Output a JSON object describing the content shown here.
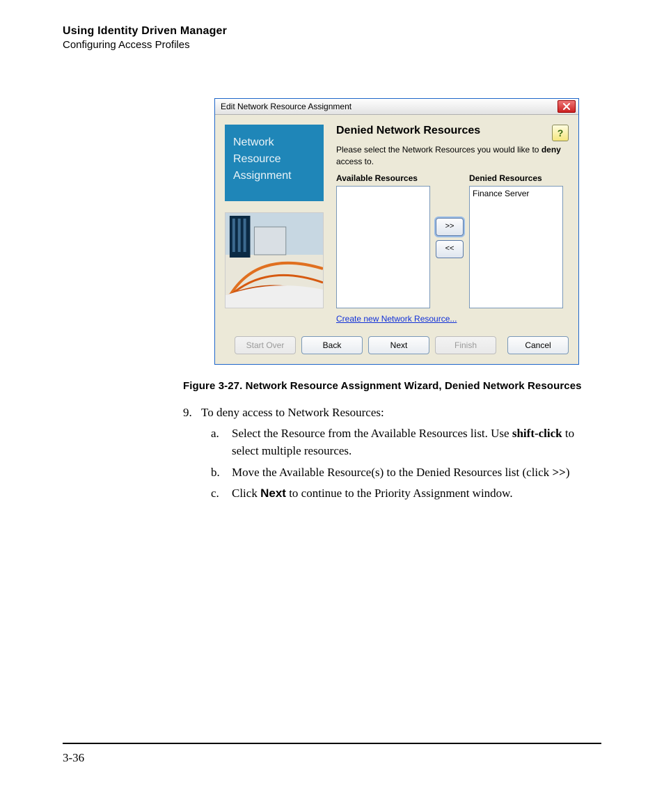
{
  "header": {
    "title": "Using Identity Driven Manager",
    "subtitle": "Configuring Access Profiles"
  },
  "dialog": {
    "title": "Edit Network Resource Assignment",
    "close_icon": "close",
    "sidebar": {
      "line1": "Network",
      "line2": "Resource",
      "line3": "Assignment"
    },
    "heading": "Denied Network Resources",
    "help_icon": "?",
    "instruction_pre": "Please select the Network Resources you would like to ",
    "instruction_bold": "deny",
    "instruction_post": " access to.",
    "available_label": "Available Resources",
    "denied_label": "Denied Resources",
    "available_items": [],
    "denied_items": [
      "Finance Server"
    ],
    "move_right": ">>",
    "move_left": "<<",
    "create_link": "Create new Network Resource...",
    "buttons": {
      "start_over": "Start Over",
      "back": "Back",
      "next": "Next",
      "finish": "Finish",
      "cancel": "Cancel"
    }
  },
  "caption": "Figure 3-27. Network Resource Assignment Wizard, Denied Network Resources",
  "step": {
    "num": "9.",
    "text": "To deny access to Network Resources:",
    "a": {
      "n": "a.",
      "t1": "Select the Resource from the Available Resources list. Use ",
      "b": "shift-click",
      "t2": " to select multiple resources."
    },
    "b": {
      "n": "b.",
      "t1": "Move the Available Resource(s) to the Denied Resources list (click ",
      "b": ">>",
      "t2": ")"
    },
    "c": {
      "n": "c.",
      "t1": "Click ",
      "b": "Next",
      "t2": " to continue to the Priority Assignment window."
    }
  },
  "page_number": "3-36"
}
